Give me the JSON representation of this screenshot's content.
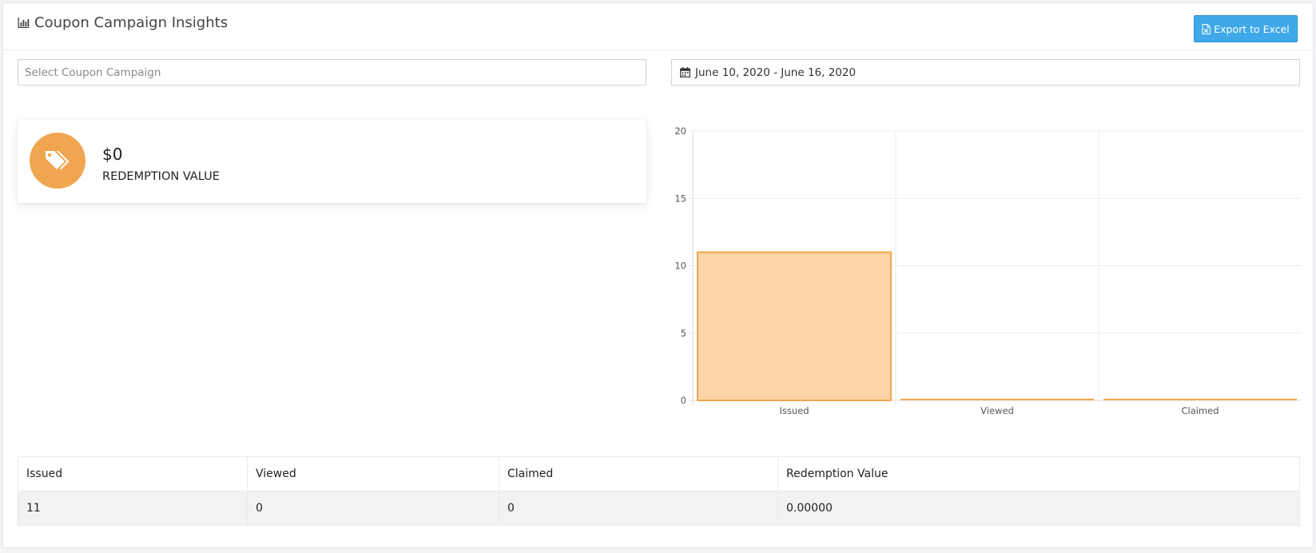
{
  "header": {
    "title": "Coupon Campaign Insights",
    "title_icon": "bar-chart-icon",
    "export_label": "Export to Excel",
    "export_icon": "excel-file-icon"
  },
  "filters": {
    "campaign_placeholder": "Select Coupon Campaign",
    "campaign_value": "",
    "date_range": "June 10, 2020 - June 16, 2020",
    "date_icon": "calendar-icon"
  },
  "stat_card": {
    "icon": "tags-icon",
    "value": "$0",
    "label": "REDEMPTION VALUE",
    "color": "#f0a551"
  },
  "chart_data": {
    "type": "bar",
    "categories": [
      "Issued",
      "Viewed",
      "Claimed"
    ],
    "values": [
      11,
      0,
      0
    ],
    "ylim": [
      0,
      20
    ],
    "yticks": [
      0,
      5,
      10,
      15,
      20
    ],
    "xlabel": "",
    "ylabel": "",
    "grid": true,
    "bar_fill": "#fdd5a8",
    "bar_stroke": "#f7a44a"
  },
  "table": {
    "columns": [
      "Issued",
      "Viewed",
      "Claimed",
      "Redemption Value"
    ],
    "rows": [
      [
        "11",
        "0",
        "0",
        "0.00000"
      ]
    ]
  },
  "colors": {
    "accent": "#3ea8e8",
    "orange": "#f0a551"
  }
}
